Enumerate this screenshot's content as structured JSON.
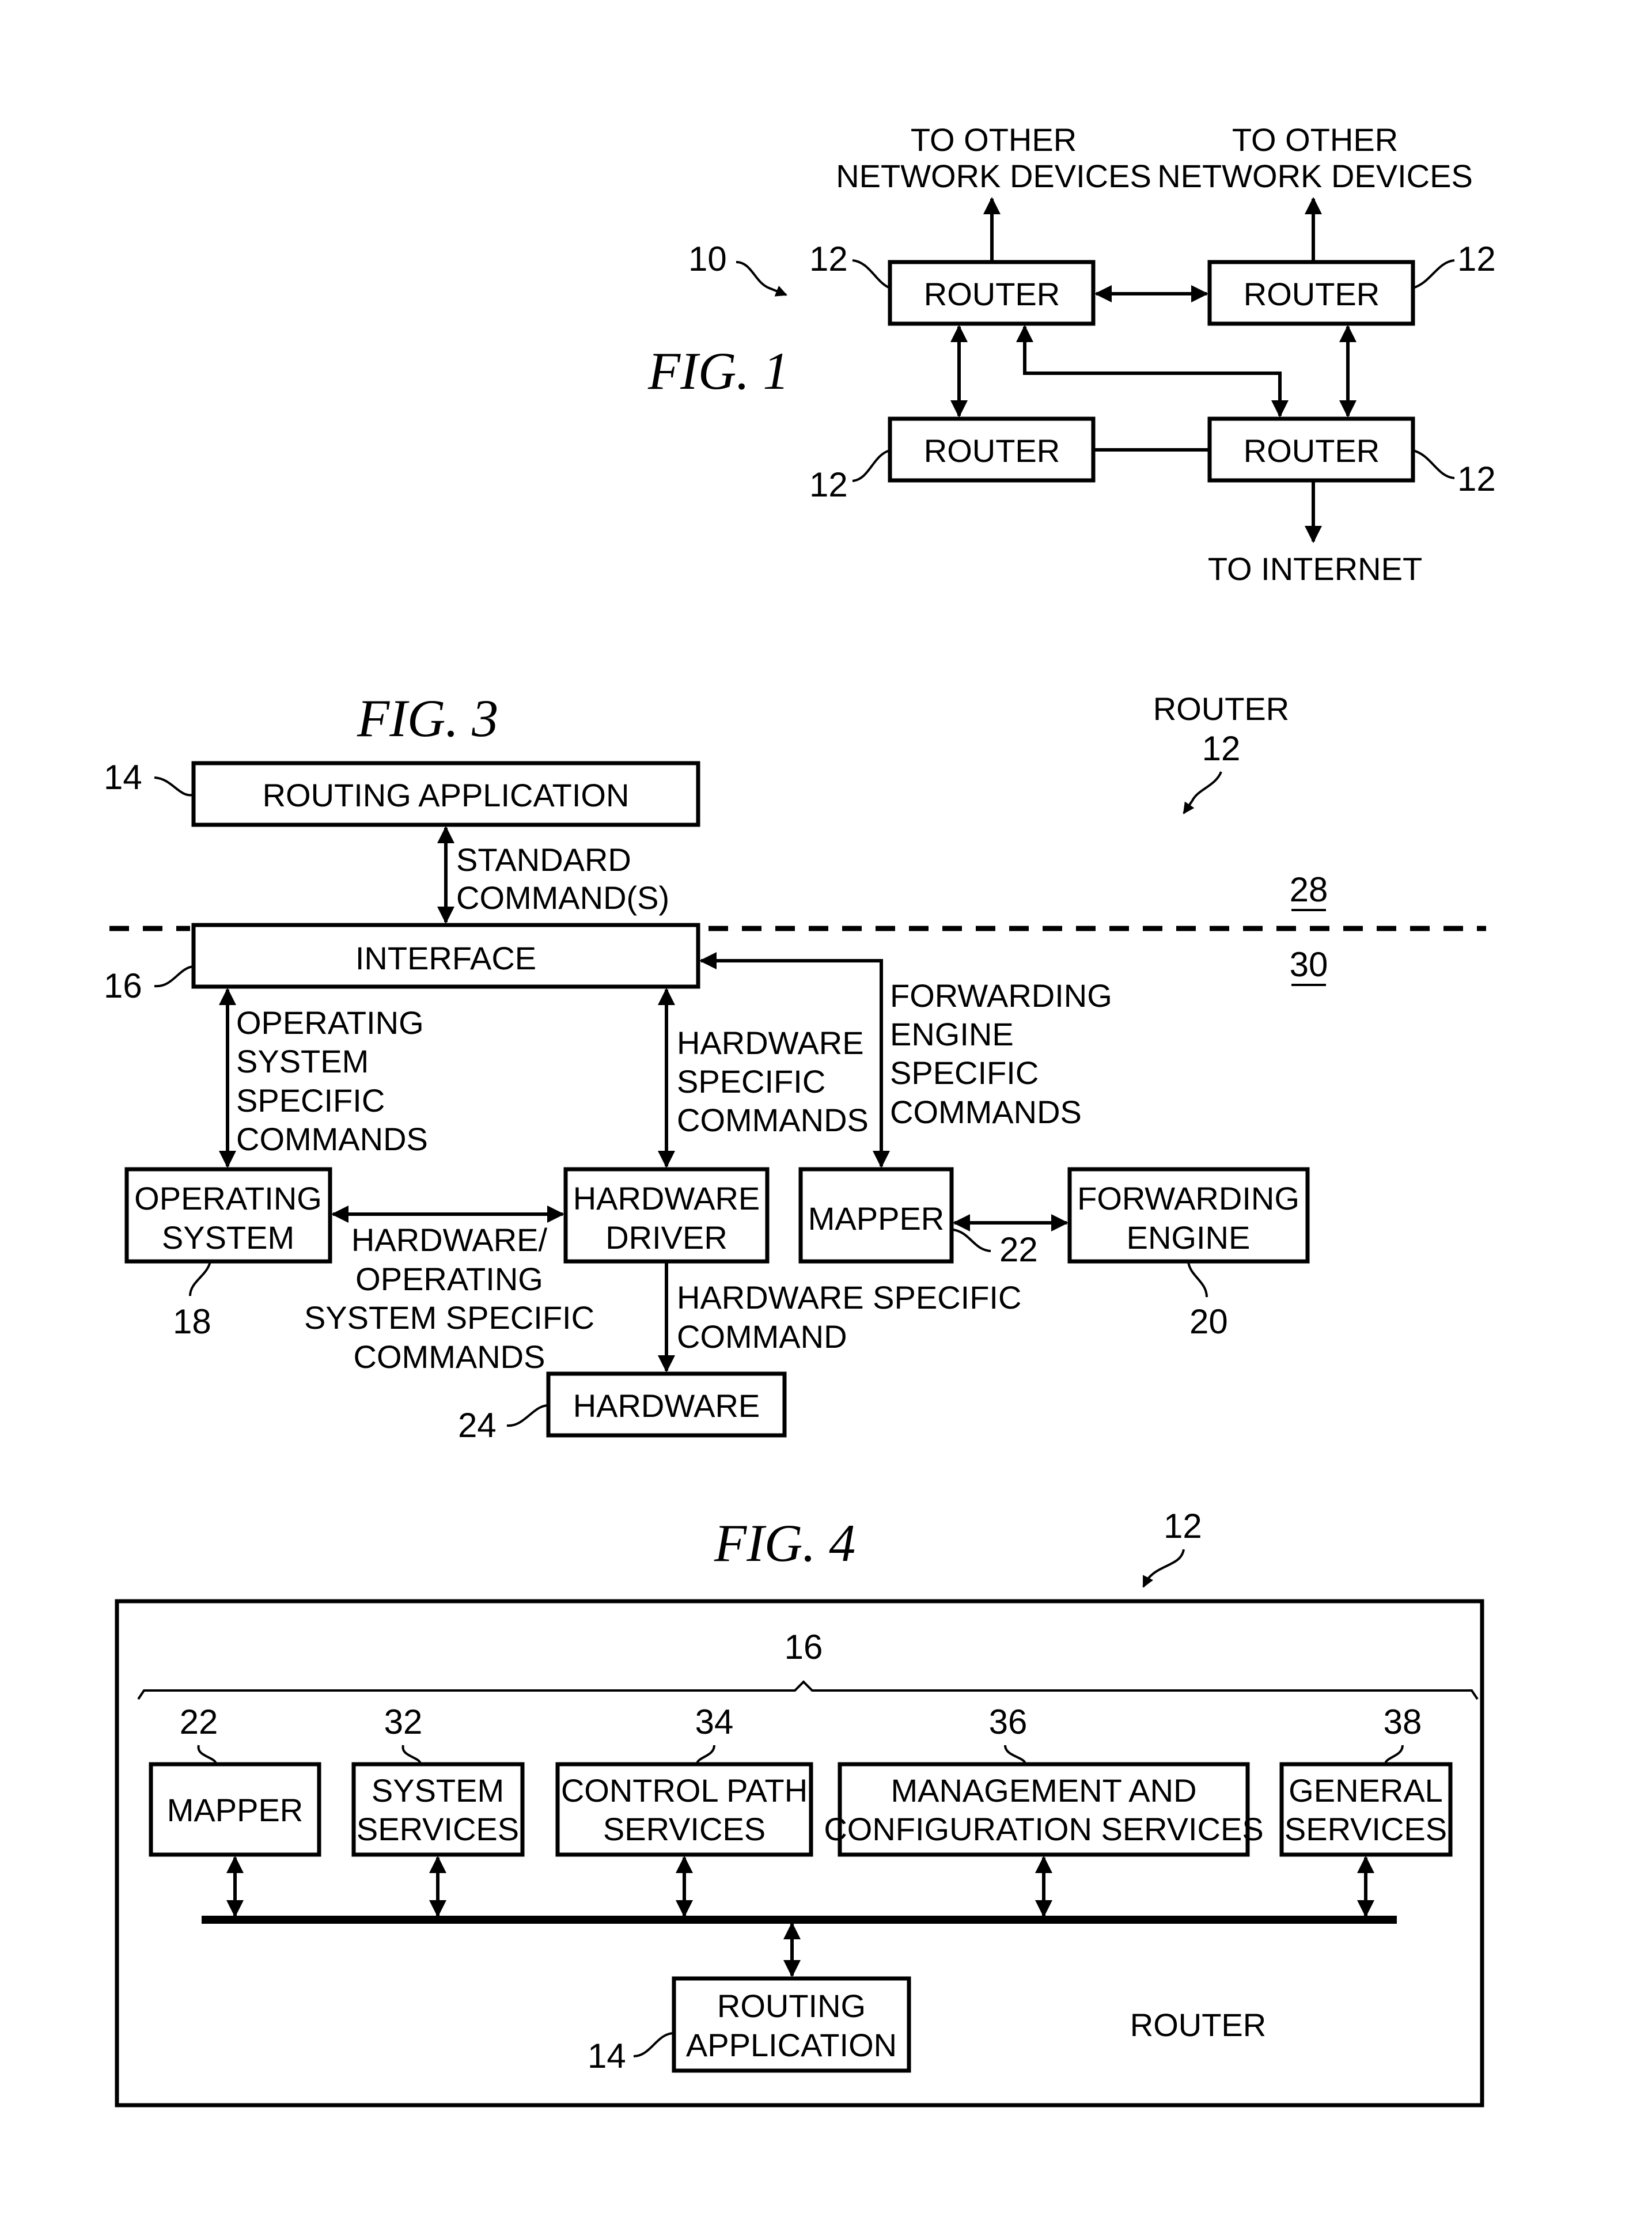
{
  "fig1": {
    "title": "FIG. 1",
    "system_ref": "10",
    "router_ref": "12",
    "router_label": "ROUTER",
    "to_other_1": [
      "TO OTHER",
      "NETWORK DEVICES"
    ],
    "to_other_2": [
      "TO OTHER",
      "NETWORK DEVICES"
    ],
    "to_internet": "TO INTERNET"
  },
  "fig3": {
    "title": "FIG. 3",
    "router_caption": "ROUTER",
    "router_ref": "12",
    "region_upper": "28",
    "region_lower": "30",
    "routing_application": {
      "label": "ROUTING APPLICATION",
      "ref": "14"
    },
    "interface": {
      "label": "INTERFACE",
      "ref": "16"
    },
    "operating_system": {
      "lines": [
        "OPERATING",
        "SYSTEM"
      ],
      "ref": "18"
    },
    "hardware_driver": {
      "lines": [
        "HARDWARE",
        "DRIVER"
      ]
    },
    "mapper": {
      "label": "MAPPER",
      "ref": "22"
    },
    "forwarding_engine": {
      "lines": [
        "FORWARDING",
        "ENGINE"
      ],
      "ref": "20"
    },
    "hardware": {
      "label": "HARDWARE",
      "ref": "24"
    },
    "edge_standard": [
      "STANDARD",
      "COMMAND(S)"
    ],
    "edge_os_specific": [
      "OPERATING",
      "SYSTEM",
      "SPECIFIC",
      "COMMANDS"
    ],
    "edge_hw_specific": [
      "HARDWARE",
      "SPECIFIC",
      "COMMANDS"
    ],
    "edge_fe_specific": [
      "FORWARDING",
      "ENGINE",
      "SPECIFIC",
      "COMMANDS"
    ],
    "edge_hw_os": [
      "HARDWARE/",
      "OPERATING",
      "SYSTEM SPECIFIC",
      "COMMANDS"
    ],
    "edge_hw_command": [
      "HARDWARE SPECIFIC",
      "COMMAND"
    ]
  },
  "fig4": {
    "title": "FIG. 4",
    "router_ref": "12",
    "interface_ref": "16",
    "router_label": "ROUTER",
    "services": [
      {
        "ref": "22",
        "lines": [
          "MAPPER"
        ]
      },
      {
        "ref": "32",
        "lines": [
          "SYSTEM",
          "SERVICES"
        ]
      },
      {
        "ref": "34",
        "lines": [
          "CONTROL PATH",
          "SERVICES"
        ]
      },
      {
        "ref": "36",
        "lines": [
          "MANAGEMENT AND",
          "CONFIGURATION SERVICES"
        ]
      },
      {
        "ref": "38",
        "lines": [
          "GENERAL",
          "SERVICES"
        ]
      }
    ],
    "routing_application": {
      "lines": [
        "ROUTING",
        "APPLICATION"
      ],
      "ref": "14"
    }
  }
}
